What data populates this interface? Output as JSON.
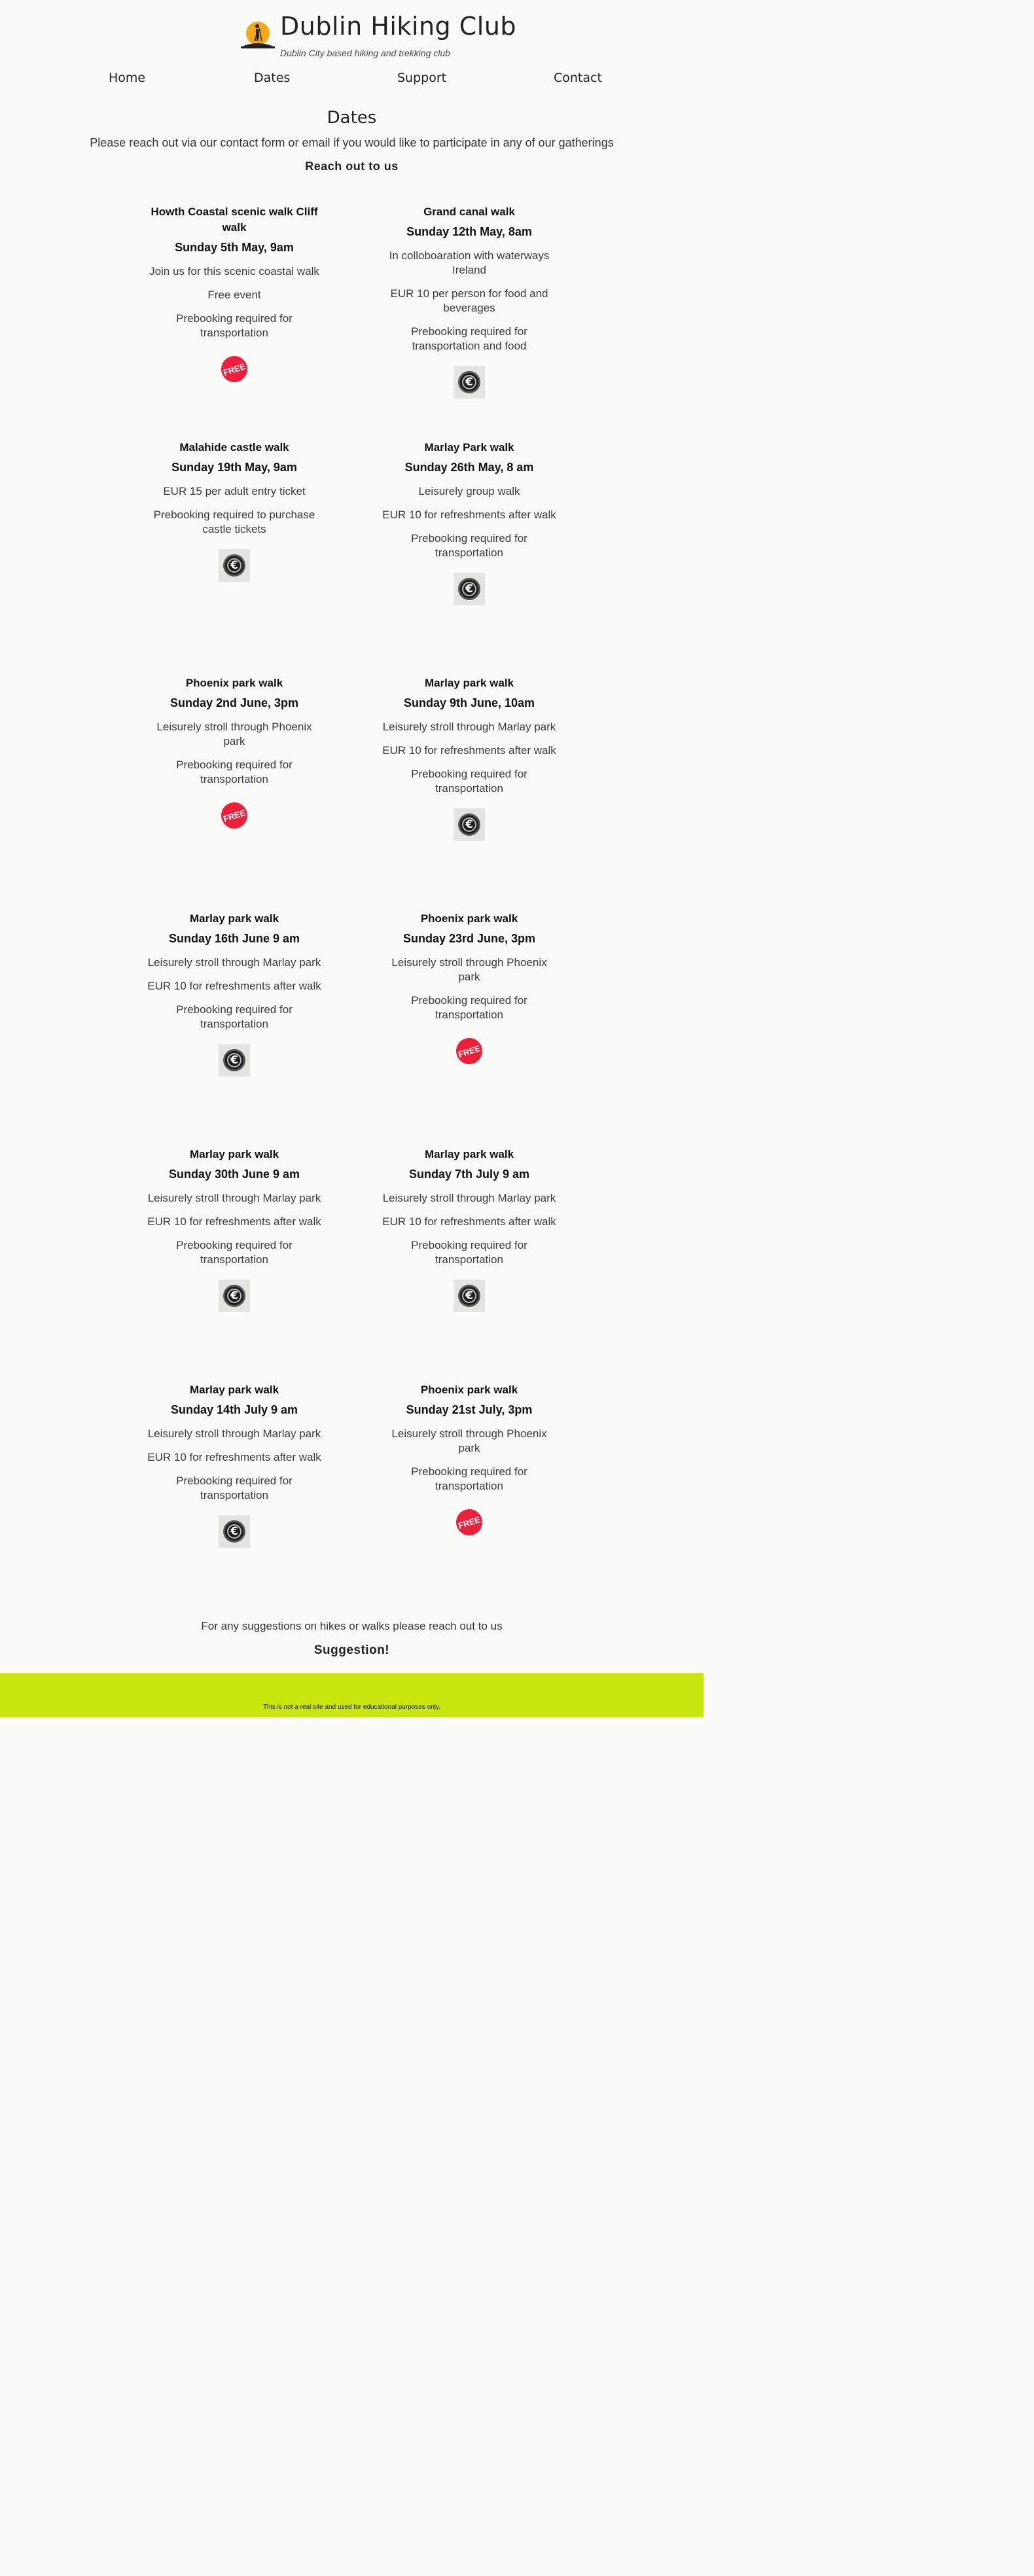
{
  "site": {
    "title": "Dublin Hiking Club",
    "tagline": "Dublin City based hiking and trekking club",
    "colors": {
      "accent": "#c9e60f",
      "free_badge": "#ee1f3b",
      "background": "#fbfbf9"
    }
  },
  "nav": [
    {
      "label": "Home"
    },
    {
      "label": "Dates"
    },
    {
      "label": "Support"
    },
    {
      "label": "Contact"
    }
  ],
  "page": {
    "title": "Dates",
    "intro": "Please reach out via our contact form or email if you would like to participate in any of our gatherings",
    "reach_label": "Reach out to us"
  },
  "events": [
    {
      "title": "Howth Coastal scenic walk Cliff walk",
      "date": "Sunday 5th May, 9am",
      "details": [
        "Join us for this scenic coastal walk",
        "Free event",
        "Prebooking required for transportation"
      ],
      "icon": "free-badge-icon",
      "icon_text": "FREE"
    },
    {
      "title": "Grand canal walk",
      "date": "Sunday 12th May, 8am",
      "details": [
        "In colloboaration with waterways Ireland",
        "EUR 10 per person for food and beverages",
        "Prebooking required for transportation and food"
      ],
      "icon": "euro-icon",
      "icon_text": "€"
    },
    {
      "title": "Malahide castle walk",
      "date": "Sunday 19th May, 9am",
      "details": [
        "EUR 15 per adult entry ticket",
        "Prebooking required to purchase castle tickets"
      ],
      "icon": "euro-icon",
      "icon_text": "€"
    },
    {
      "title": "Marlay Park walk",
      "date": "Sunday 26th May, 8 am",
      "details": [
        "Leisurely group walk",
        "EUR 10 for refreshments after walk",
        "Prebooking required for transportation"
      ],
      "icon": "euro-icon",
      "icon_text": "€"
    },
    {
      "title": "Phoenix park walk",
      "date": "Sunday 2nd June, 3pm",
      "details": [
        "Leisurely stroll through Phoenix park",
        "Prebooking required for transportation"
      ],
      "icon": "free-badge-icon",
      "icon_text": "FREE"
    },
    {
      "title": "Marlay park walk",
      "date": "Sunday 9th June, 10am",
      "details": [
        "Leisurely stroll through Marlay park",
        "EUR 10 for refreshments after walk",
        "Prebooking required for transportation"
      ],
      "icon": "euro-icon",
      "icon_text": "€"
    },
    {
      "title": "Marlay park walk",
      "date": "Sunday 16th June 9 am",
      "details": [
        "Leisurely stroll through Marlay park",
        "EUR 10 for refreshments after walk",
        "Prebooking required for transportation"
      ],
      "icon": "euro-icon",
      "icon_text": "€"
    },
    {
      "title": "Phoenix park walk",
      "date": "Sunday 23rd June, 3pm",
      "details": [
        "Leisurely stroll through Phoenix park",
        "Prebooking required for transportation"
      ],
      "icon": "free-badge-icon",
      "icon_text": "FREE"
    },
    {
      "title": "Marlay park walk",
      "date": "Sunday 30th June 9 am",
      "details": [
        "Leisurely stroll through Marlay park",
        "EUR 10 for refreshments after walk",
        "Prebooking required for transportation"
      ],
      "icon": "euro-icon",
      "icon_text": "€"
    },
    {
      "title": "Marlay park walk",
      "date": "Sunday 7th July 9 am",
      "details": [
        "Leisurely stroll through Marlay park",
        "EUR 10 for refreshments after walk",
        "Prebooking required for transportation"
      ],
      "icon": "euro-icon",
      "icon_text": "€"
    },
    {
      "title": "Marlay park walk",
      "date": "Sunday 14th July 9 am",
      "details": [
        "Leisurely stroll through Marlay park",
        "EUR 10 for refreshments after walk",
        "Prebooking required for transportation"
      ],
      "icon": "euro-icon",
      "icon_text": "€"
    },
    {
      "title": "Phoenix park walk",
      "date": "Sunday 21st July, 3pm",
      "details": [
        "Leisurely stroll through Phoenix park",
        "Prebooking required for transportation"
      ],
      "icon": "free-badge-icon",
      "icon_text": "FREE"
    }
  ],
  "suggestions": {
    "text": "For any suggestions on hikes or walks please reach out to us",
    "link_label": "Suggestion!"
  },
  "footer": {
    "text": "This is not a real site and used for educational purposes only."
  }
}
